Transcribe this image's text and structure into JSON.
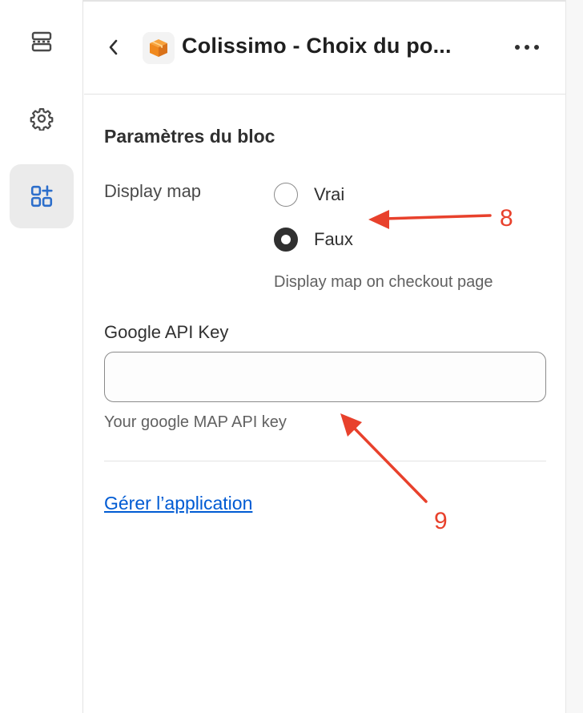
{
  "header": {
    "title": "Colissimo - Choix du po...",
    "app_icon": "package-box-icon",
    "back_icon": "chevron-left-icon",
    "more_icon": "more-horizontal-icon"
  },
  "sidebar": {
    "items": [
      {
        "icon": "sections-layout-icon"
      },
      {
        "icon": "gear-icon"
      },
      {
        "icon": "apps-add-icon",
        "active": true
      }
    ]
  },
  "block_settings": {
    "title": "Paramètres du bloc",
    "display_map": {
      "label": "Display map",
      "options": [
        {
          "label": "Vrai",
          "checked": false
        },
        {
          "label": "Faux",
          "checked": true
        }
      ],
      "help": "Display map on checkout page"
    },
    "google_api_key": {
      "label": "Google API Key",
      "value": "",
      "placeholder": "",
      "help": "Your google MAP API key"
    },
    "manage_link": "Gérer l’application"
  },
  "annotations": {
    "marker_8": "8",
    "marker_9": "9",
    "color": "#e8412c"
  },
  "colors": {
    "active_rail": "#ebebeb",
    "link": "#005bd3",
    "text": "#303030",
    "icon_accent": "#2c6ecb",
    "app_icon_orange": "#f0891e"
  }
}
